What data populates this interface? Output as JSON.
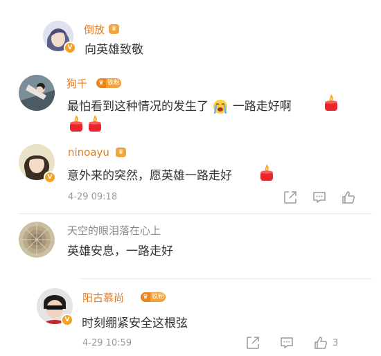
{
  "comments": [
    {
      "username": "倒放",
      "text": "向英雄致敬"
    },
    {
      "username": "狗千",
      "fan_badge": "铁粉",
      "text": "最怕看到这种情况的发生了",
      "text_after": "一路走好啊"
    },
    {
      "username": "ninoayu",
      "text": "意外来的突然，愿英雄一路走好",
      "time": "4-29 09:18"
    },
    {
      "username": "天空的眼泪落在心上",
      "text": "英雄安息，一路走好"
    },
    {
      "username": "阳古慕尚",
      "fan_badge": "铁粉",
      "text": "时刻绷紧安全这根弦",
      "time": "4-29 10:59",
      "like_count": "3"
    }
  ],
  "icons": {
    "share": "share-icon",
    "comment": "comment-icon",
    "like": "thumbs-up-icon",
    "candle": "candle-emoji-icon",
    "cry": "crying-face-emoji-icon",
    "crown": "crown-badge-icon",
    "verified": "verified-v-icon"
  },
  "colors": {
    "username": "#e8791a",
    "username_plain": "#8a8a8a",
    "text": "#333333",
    "meta": "#999999",
    "badge": "#f3a23b"
  }
}
